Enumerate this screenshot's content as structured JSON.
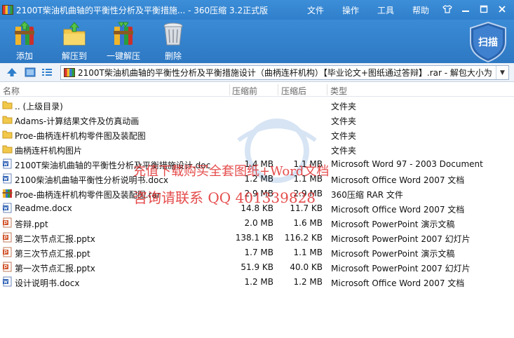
{
  "window": {
    "title": "2100T柴油机曲轴的平衡性分析及平衡措施... - 360压缩 3.2正式版",
    "menu": [
      "文件",
      "操作",
      "工具",
      "帮助"
    ]
  },
  "toolbar": {
    "add": "添加",
    "extract_to": "解压到",
    "one_click_extract": "一键解压",
    "delete": "删除",
    "scan": "扫描"
  },
  "address": {
    "path": "2100T柴油机曲轴的平衡性分析及平衡措施设计（曲柄连杆机构）【毕业论文+图纸通过答辩】.rar - 解包大小为"
  },
  "columns": {
    "name": "名称",
    "size": "压缩前",
    "packed": "压缩后",
    "type": "类型"
  },
  "files": [
    {
      "name": ".. (上级目录)",
      "size": "",
      "packed": "",
      "type": "文件夹",
      "icon": "folder"
    },
    {
      "name": "Adams-计算结果文件及仿真动画",
      "size": "",
      "packed": "",
      "type": "文件夹",
      "icon": "folder"
    },
    {
      "name": "Proe-曲柄连杆机构零件图及装配图",
      "size": "",
      "packed": "",
      "type": "文件夹",
      "icon": "folder"
    },
    {
      "name": "曲柄连杆机构图片",
      "size": "",
      "packed": "",
      "type": "文件夹",
      "icon": "folder"
    },
    {
      "name": "2100T柴油机曲轴的平衡性分析及平衡措施设计.doc",
      "size": "1.4 MB",
      "packed": "1.1 MB",
      "type": "Microsoft Word 97 - 2003 Document",
      "icon": "word"
    },
    {
      "name": "2100柴油机曲轴平衡性分析说明书.docx",
      "size": "1.2 MB",
      "packed": "1.1 MB",
      "type": "Microsoft Office Word 2007 文档",
      "icon": "word"
    },
    {
      "name": "Proe-曲柄连杆机构零件图及装配图.rar",
      "size": "2.9 MB",
      "packed": "2.9 MB",
      "type": "360压缩 RAR 文件",
      "icon": "rar"
    },
    {
      "name": "Readme.docx",
      "size": "14.8 KB",
      "packed": "11.7 KB",
      "type": "Microsoft Office Word 2007 文档",
      "icon": "word"
    },
    {
      "name": "答辩.ppt",
      "size": "2.0 MB",
      "packed": "1.6 MB",
      "type": "Microsoft PowerPoint 演示文稿",
      "icon": "ppt"
    },
    {
      "name": "第二次节点汇报.pptx",
      "size": "138.1 KB",
      "packed": "116.2 KB",
      "type": "Microsoft PowerPoint 2007 幻灯片",
      "icon": "ppt"
    },
    {
      "name": "第三次节点汇报.ppt",
      "size": "1.7 MB",
      "packed": "1.1 MB",
      "type": "Microsoft PowerPoint 演示文稿",
      "icon": "ppt"
    },
    {
      "name": "第一次节点汇报.pptx",
      "size": "51.9 KB",
      "packed": "40.0 KB",
      "type": "Microsoft PowerPoint 2007 幻灯片",
      "icon": "ppt"
    },
    {
      "name": "设计说明书.docx",
      "size": "1.2 MB",
      "packed": "1.2 MB",
      "type": "Microsoft Office Word 2007 文档",
      "icon": "word"
    }
  ],
  "watermark": {
    "line1": "充值下载购买全套图纸+Word文档",
    "line2": "咨询请联系  QQ 401339828"
  },
  "colors": {
    "titlebar": "#2f7fcc",
    "folder": "#f2c84b",
    "word": "#2b5fb4",
    "ppt": "#d2542a",
    "watermark": "#e12d2d"
  }
}
